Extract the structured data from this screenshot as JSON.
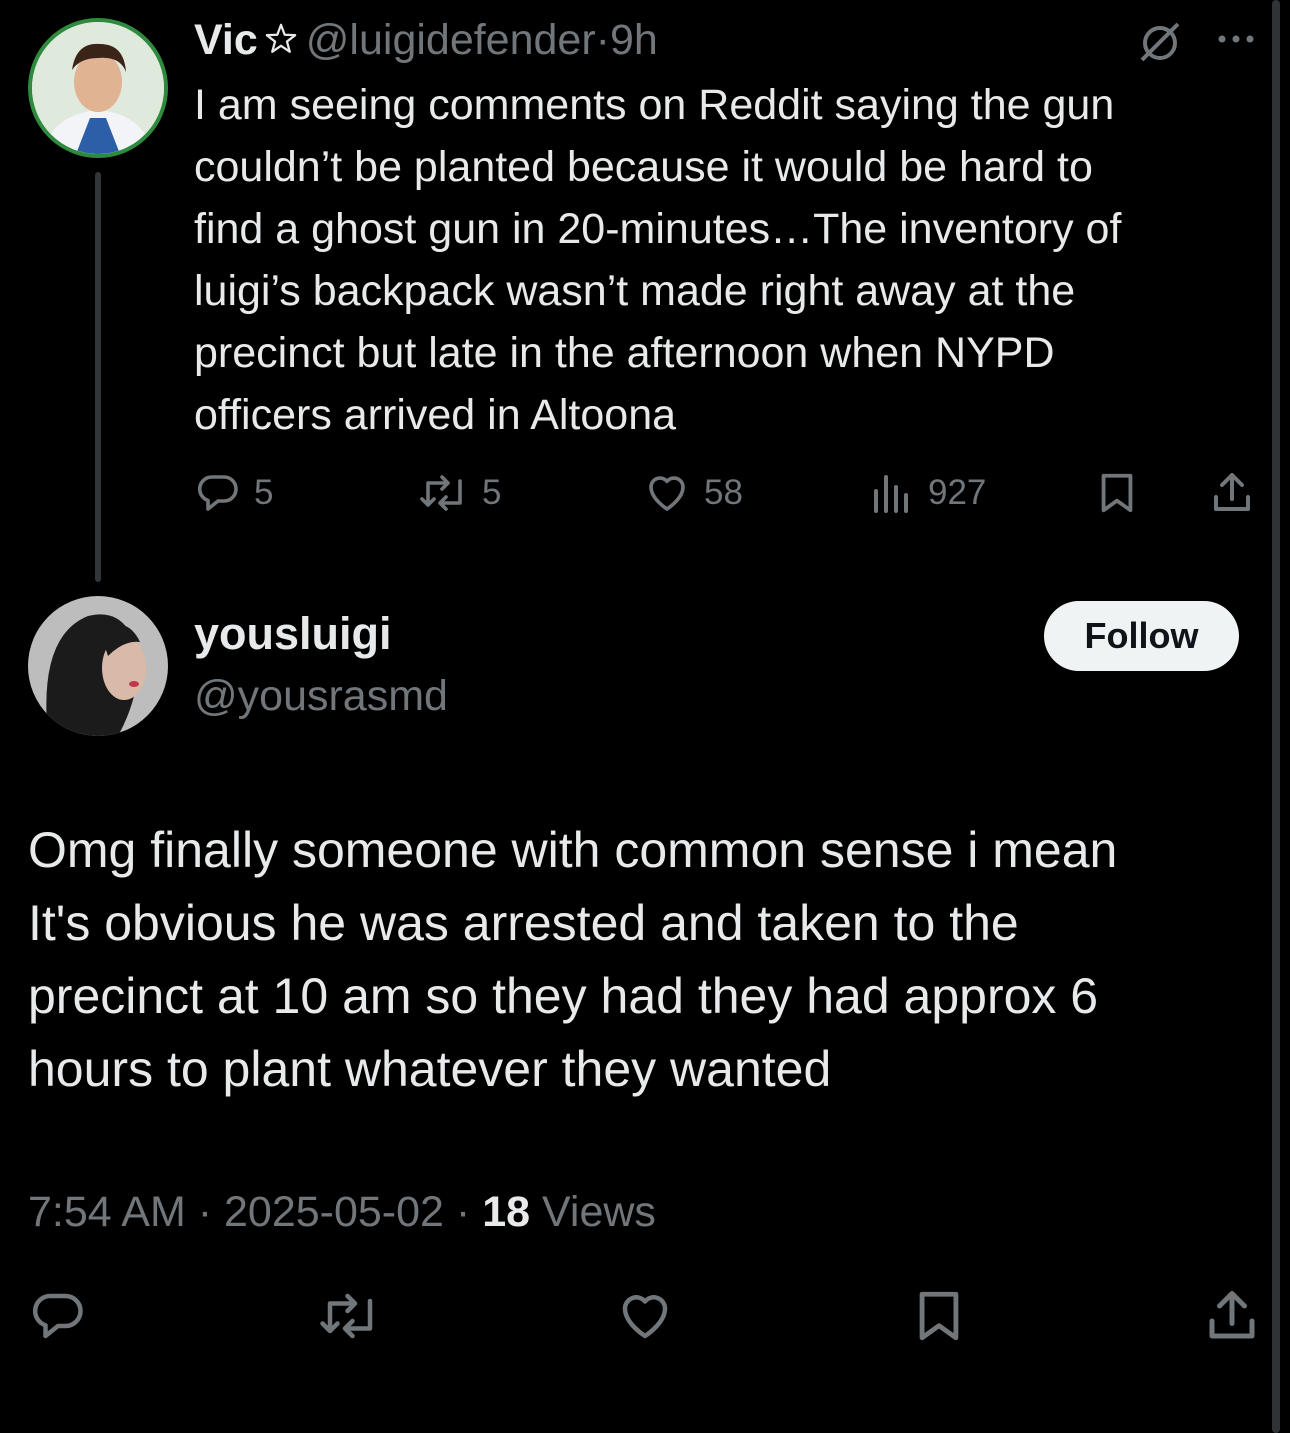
{
  "tweet1": {
    "name": "Vic",
    "handle": "@luigidefender",
    "time": "9h",
    "sep": "·",
    "text": "I am seeing comments on Reddit saying the gun\ncouldn’t be planted because it would be hard to\nfind a ghost gun in 20-minutes…The inventory of\nluigi’s backpack wasn’t made right away at the\nprecinct but late in the afternoon when NYPD\nofficers arrived in Altoona",
    "replies": "5",
    "reposts": "5",
    "likes": "58",
    "views": "927"
  },
  "tweet2": {
    "name": "yousluigi",
    "handle": "@yousrasmd",
    "follow_label": "Follow",
    "text": "Omg finally someone with common sense i mean\nIt's obvious he was arrested and taken to the\nprecinct at 10 am so they had they had approx 6\nhours to plant whatever they wanted",
    "time": "7:54 AM",
    "date": "2025-05-02",
    "sep": "·",
    "views_count": "18",
    "views_label": "Views"
  },
  "icons": {
    "star": "star-outline-icon",
    "grok": "slashed-circle-icon",
    "more": "more-dots-icon",
    "reply": "reply-bubble-icon",
    "repost": "repost-icon",
    "like": "heart-icon",
    "views": "views-bars-icon",
    "bookmark": "bookmark-icon",
    "share": "share-upload-icon"
  },
  "colors": {
    "background": "#000000",
    "text": "#e7e9ea",
    "muted": "#71767b",
    "avatar_ring": "#2e8b3e",
    "follow_bg": "#eff3f4"
  }
}
